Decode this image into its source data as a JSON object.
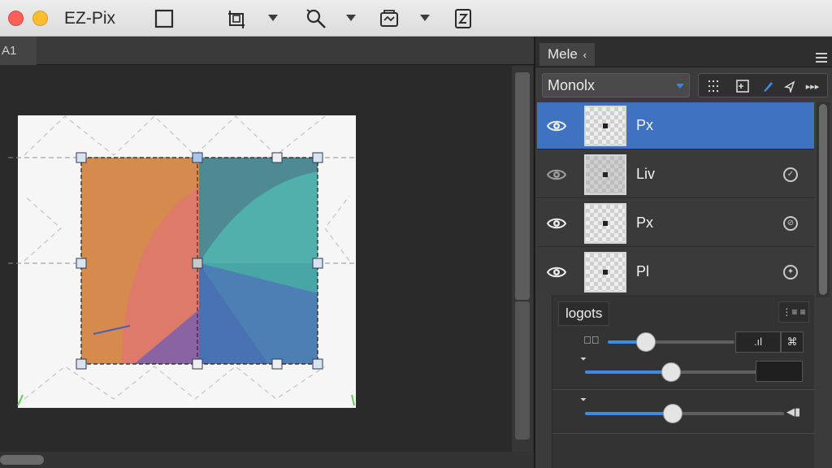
{
  "window": {
    "title": "EZ-Pix",
    "close_color": "#fe5f57",
    "minimize_color": "#febc2e"
  },
  "toolbar": {
    "icons": [
      "crop-square-icon",
      "transform-icon",
      "zoom-icon",
      "adjust-icon",
      "export-icon"
    ]
  },
  "document": {
    "tab_label": "A1"
  },
  "layers_panel": {
    "tab_label": "Mele",
    "blend_mode": "Monolx",
    "layers": [
      {
        "name": "Px",
        "selected": true,
        "badge": ""
      },
      {
        "name": "Liv",
        "selected": false,
        "badge": "✓"
      },
      {
        "name": "Px",
        "selected": false,
        "badge": "⊘"
      },
      {
        "name": "Pl",
        "selected": false,
        "badge": "✦"
      }
    ]
  },
  "properties": {
    "title": "logots",
    "sliders": [
      {
        "value": 0.3
      },
      {
        "value": 0.5
      },
      {
        "value": 0.5
      }
    ]
  },
  "colors": {
    "accent": "#3f73c1",
    "slider": "#3f8ae6",
    "canvas_bg": "#2a2a2a"
  }
}
